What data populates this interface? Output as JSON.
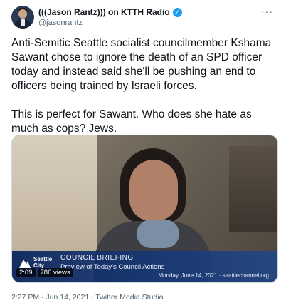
{
  "tweet": {
    "display_name": "(((Jason Rantz))) on KTTH Radio",
    "handle": "@jasonrantz",
    "more_label": "···",
    "body": "Anti-Semitic Seattle socialist councilmember Kshama Sawant chose to ignore the death of an SPD officer today and instead said she'll be pushing an end to officers being trained by Israeli forces.\n\nThis is perfect for Sawant. Who does she hate as much as cops? Jews.",
    "media": {
      "logo_text": "Seattle\nCity",
      "lower_title": "COUNCIL BRIEFING",
      "lower_subtitle": "Preview of Today's Council Actions",
      "lower_date": "Monday, June 14, 2021 · seattlechannel.org",
      "duration": "2:09",
      "views": "786 views"
    },
    "timestamp": "2:27 PM · Jun 14, 2021",
    "separator": " · ",
    "source": "Twitter Media Studio"
  },
  "colors": {
    "verified_blue": "#1d9bf0",
    "secondary_text": "#536471"
  },
  "icons": {
    "verified": "verified-badge-icon",
    "more": "more-dots-icon",
    "logo": "seattle-channel-logo-icon"
  }
}
